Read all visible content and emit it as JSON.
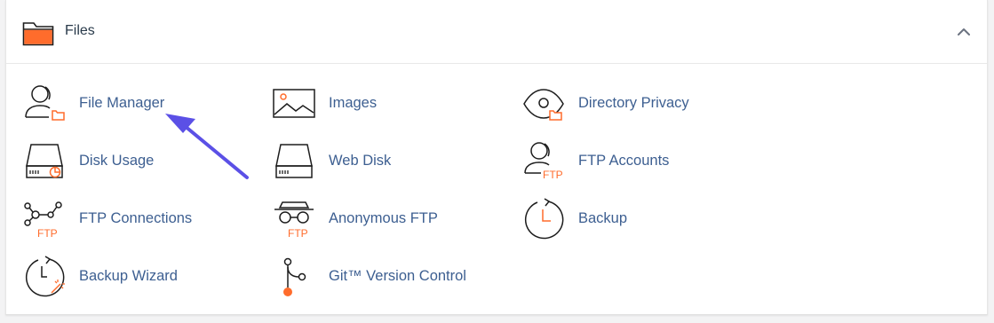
{
  "section": {
    "title": "Files",
    "header_icon": "folder-icon",
    "collapse_icon": "chevron-up-icon"
  },
  "colors": {
    "link": "#3d5f91",
    "accent": "#ff6c2c",
    "icon_stroke": "#1d1d1d",
    "annotation_arrow": "#5b50e6"
  },
  "items": [
    {
      "label": "File Manager",
      "icon": "file-manager-icon"
    },
    {
      "label": "Images",
      "icon": "images-icon"
    },
    {
      "label": "Directory Privacy",
      "icon": "directory-privacy-icon"
    },
    {
      "label": "Disk Usage",
      "icon": "disk-usage-icon"
    },
    {
      "label": "Web Disk",
      "icon": "web-disk-icon"
    },
    {
      "label": "FTP Accounts",
      "icon": "ftp-accounts-icon"
    },
    {
      "label": "FTP Connections",
      "icon": "ftp-connections-icon"
    },
    {
      "label": "Anonymous FTP",
      "icon": "anonymous-ftp-icon"
    },
    {
      "label": "Backup",
      "icon": "backup-icon"
    },
    {
      "label": "Backup Wizard",
      "icon": "backup-wizard-icon"
    },
    {
      "label": "Git™ Version Control",
      "icon": "git-version-control-icon"
    }
  ],
  "icon_text": {
    "ftp": "FTP"
  },
  "annotation": {
    "icon": "arrow-icon"
  }
}
